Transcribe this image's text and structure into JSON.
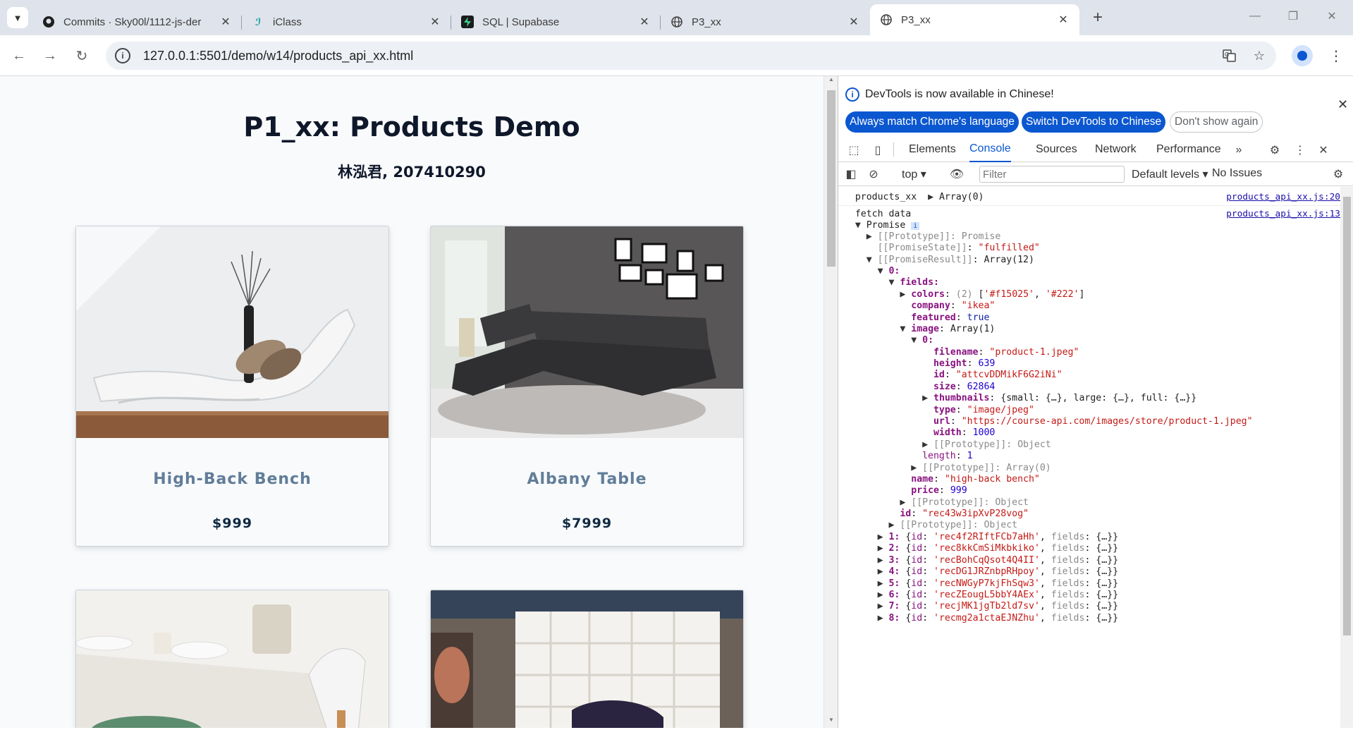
{
  "tabs": [
    {
      "title": "Commits · Sky00l/1112-js-der",
      "icon": "github-icon"
    },
    {
      "title": "iClass",
      "icon": "iclass-icon"
    },
    {
      "title": "SQL | Supabase",
      "icon": "supabase-icon"
    },
    {
      "title": "P3_xx",
      "icon": "globe-icon"
    },
    {
      "title": "P3_xx",
      "icon": "globe-icon"
    }
  ],
  "address": {
    "url": "127.0.0.1:5501/demo/w14/products_api_xx.html"
  },
  "page": {
    "title": "P1_xx: Products Demo",
    "subtitle": "林泓君, 207410290",
    "products": [
      {
        "name": "High-Back Bench",
        "price": "$999"
      },
      {
        "name": "Albany Table",
        "price": "$7999"
      }
    ]
  },
  "devtools": {
    "banner": "DevTools is now available in Chinese!",
    "btn_match": "Always match Chrome's language",
    "btn_switch": "Switch DevTools to Chinese",
    "btn_dont": "Don't show again",
    "tabs": [
      "Elements",
      "Console",
      "Sources",
      "Network",
      "Performance"
    ],
    "context": "top",
    "filter_placeholder": "Filter",
    "levels": "Default levels",
    "issues": "No Issues",
    "log1": {
      "label": "products_xx",
      "value": "Array(0)",
      "source": "products_api_xx.js:20"
    },
    "log2": {
      "label": "fetch data",
      "source": "products_api_xx.js:13"
    },
    "tree": {
      "promise": "Promise",
      "proto_promise": "[[Prototype]]: Promise",
      "state_key": "[[PromiseState]]",
      "state_val": "\"fulfilled\"",
      "result_key": "[[PromiseResult]]",
      "result_val": "Array(12)",
      "item0": "0:",
      "fields": "fields:",
      "colors_key": "colors",
      "colors_count": "(2)",
      "colors_val1": "'#f15025'",
      "colors_val2": "'#222'",
      "company_key": "company",
      "company_val": "\"ikea\"",
      "featured_key": "featured",
      "featured_val": "true",
      "image_key": "image",
      "image_val": "Array(1)",
      "img0": "0:",
      "filename_key": "filename",
      "filename_val": "\"product-1.jpeg\"",
      "height_key": "height",
      "height_val": "639",
      "id_key": "id",
      "id_val": "\"attcvDDMikF6G2iNi\"",
      "size_key": "size",
      "size_val": "62864",
      "thumbs_key": "thumbnails",
      "thumbs_val": "{small: {…}, large: {…}, full: {…}}",
      "type_key": "type",
      "type_val": "\"image/jpeg\"",
      "url_key": "url",
      "url_val": "\"https://course-api.com/images/store/product-1.jpeg\"",
      "width_key": "width",
      "width_val": "1000",
      "proto_object": "[[Prototype]]: Object",
      "length_key": "length",
      "length_val": "1",
      "proto_array": "[[Prototype]]: Array(0)",
      "name_key": "name",
      "name_val": "\"high-back bench\"",
      "price_key": "price",
      "price_val": "999",
      "rec_id_key": "id",
      "rec_id_val": "\"rec43w3ipXvP28vog\""
    },
    "records": [
      {
        "idx": "1:",
        "id": "'rec4f2RIftFCb7aHh'"
      },
      {
        "idx": "2:",
        "id": "'rec8kkCmSiMkbkiko'"
      },
      {
        "idx": "3:",
        "id": "'recBohCqQsot4Q4II'"
      },
      {
        "idx": "4:",
        "id": "'recDG1JRZnbpRHpoy'"
      },
      {
        "idx": "5:",
        "id": "'recNWGyP7kjFhSqw3'"
      },
      {
        "idx": "6:",
        "id": "'recZEougL5bbY4AEx'"
      },
      {
        "idx": "7:",
        "id": "'recjMK1jgTb2ld7sv'"
      },
      {
        "idx": "8:",
        "id": "'recmg2a1ctaEJNZhu'"
      }
    ]
  }
}
